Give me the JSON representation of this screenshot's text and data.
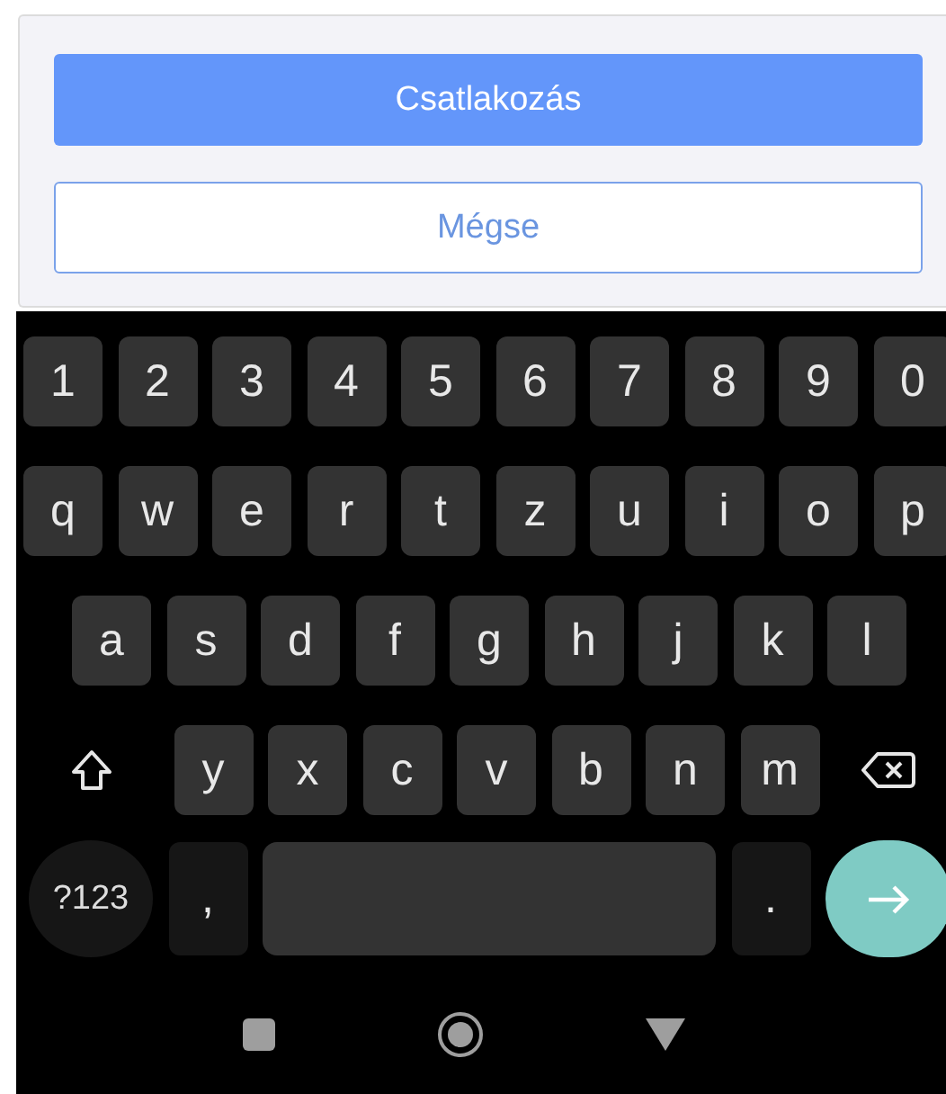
{
  "dialog": {
    "buttons": [
      {
        "label": "Csatlakozás",
        "kind": "primary"
      },
      {
        "label": "Mégse",
        "kind": "secondary"
      }
    ]
  },
  "keyboard": {
    "rows": [
      {
        "keys": [
          {
            "kind": "char",
            "label": "1"
          },
          {
            "kind": "char",
            "label": "2"
          },
          {
            "kind": "char",
            "label": "3"
          },
          {
            "kind": "char",
            "label": "4"
          },
          {
            "kind": "char",
            "label": "5"
          },
          {
            "kind": "char",
            "label": "6"
          },
          {
            "kind": "char",
            "label": "7"
          },
          {
            "kind": "char",
            "label": "8"
          },
          {
            "kind": "char",
            "label": "9"
          },
          {
            "kind": "char",
            "label": "0"
          }
        ]
      },
      {
        "keys": [
          {
            "kind": "char",
            "label": "q"
          },
          {
            "kind": "char",
            "label": "w"
          },
          {
            "kind": "char",
            "label": "e"
          },
          {
            "kind": "char",
            "label": "r"
          },
          {
            "kind": "char",
            "label": "t"
          },
          {
            "kind": "char",
            "label": "z"
          },
          {
            "kind": "char",
            "label": "u"
          },
          {
            "kind": "char",
            "label": "i"
          },
          {
            "kind": "char",
            "label": "o"
          },
          {
            "kind": "char",
            "label": "p"
          }
        ]
      },
      {
        "keys": [
          {
            "kind": "char",
            "label": "a"
          },
          {
            "kind": "char",
            "label": "s"
          },
          {
            "kind": "char",
            "label": "d"
          },
          {
            "kind": "char",
            "label": "f"
          },
          {
            "kind": "char",
            "label": "g"
          },
          {
            "kind": "char",
            "label": "h"
          },
          {
            "kind": "char",
            "label": "j"
          },
          {
            "kind": "char",
            "label": "k"
          },
          {
            "kind": "char",
            "label": "l"
          }
        ]
      },
      {
        "keys": [
          {
            "kind": "shift"
          },
          {
            "kind": "char",
            "label": "y"
          },
          {
            "kind": "char",
            "label": "x"
          },
          {
            "kind": "char",
            "label": "c"
          },
          {
            "kind": "char",
            "label": "v"
          },
          {
            "kind": "char",
            "label": "b"
          },
          {
            "kind": "char",
            "label": "n"
          },
          {
            "kind": "char",
            "label": "m"
          },
          {
            "kind": "backspace"
          }
        ]
      },
      {
        "keys": [
          {
            "kind": "symbols",
            "label": "?123"
          },
          {
            "kind": "punct",
            "label": ","
          },
          {
            "kind": "space"
          },
          {
            "kind": "punct",
            "label": "."
          },
          {
            "kind": "enter"
          }
        ]
      }
    ]
  }
}
